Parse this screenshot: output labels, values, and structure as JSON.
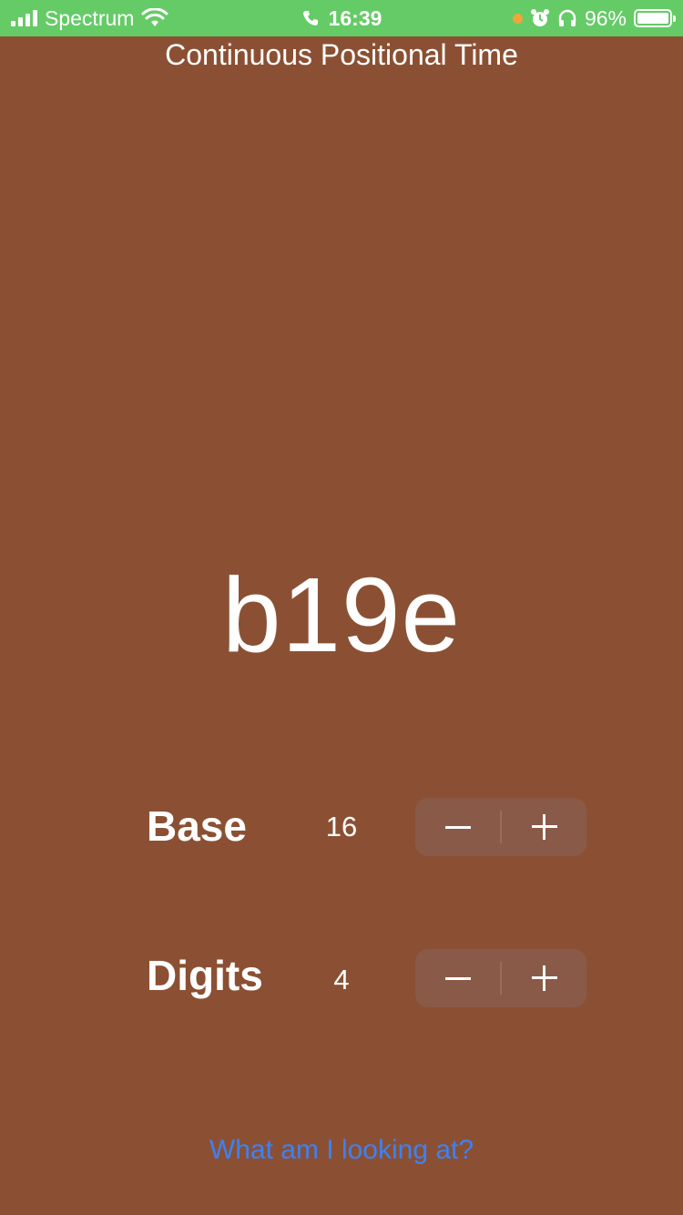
{
  "status_bar": {
    "carrier": "Spectrum",
    "time": "16:39",
    "battery": "96%",
    "icons": [
      "signal-icon",
      "wifi-icon",
      "phone-icon",
      "alarm-icon",
      "headphones-icon",
      "battery-icon"
    ],
    "color": "#65cb67"
  },
  "title": "Continuous Positional Time",
  "display": {
    "value": "b19e"
  },
  "base": {
    "label": "Base",
    "value": "16",
    "minus": "−",
    "plus": "+"
  },
  "digits": {
    "label": "Digits",
    "value": "4",
    "minus": "−",
    "plus": "+"
  },
  "help_link": "What am I looking at?",
  "colors": {
    "background": "#8b5033",
    "stepper": "#8a5a48",
    "link": "#3b82f6"
  }
}
